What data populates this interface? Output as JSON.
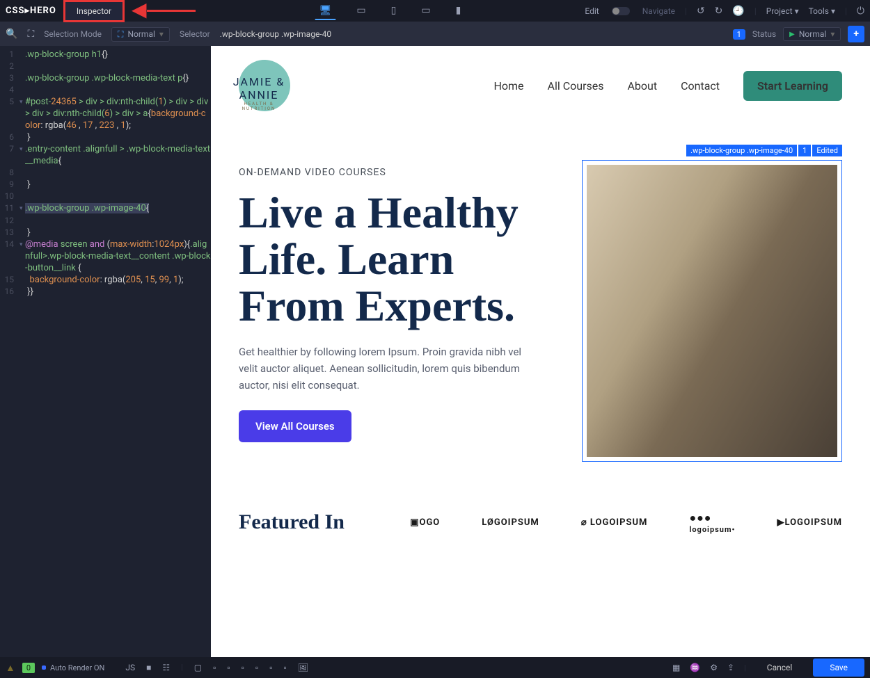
{
  "topbar": {
    "brand": "CSS▸HERO",
    "inspector_tab": "Inspector",
    "edit_label": "Edit",
    "navigate_label": "Navigate",
    "project_label": "Project",
    "tools_label": "Tools"
  },
  "subbar": {
    "selection_mode_label": "Selection Mode",
    "selection_mode_value": "Normal",
    "selector_label": "Selector",
    "selector_value": ".wp-block-group .wp-image-40",
    "count_badge": "1",
    "status_label": "Status",
    "status_value": "Normal"
  },
  "editor": {
    "lines": [
      {
        "n": "1",
        "c": ".wp-block-group h1{}"
      },
      {
        "n": "2",
        "c": ""
      },
      {
        "n": "3",
        "c": ".wp-block-group .wp-block-media-text p{}"
      },
      {
        "n": "4",
        "c": ""
      },
      {
        "n": "5",
        "c": "#post-24365 > div > div:nth-child(1) > div > div > div > div:nth-child(6) > div > a{background-color: rgba(46 , 17 , 223 , 1);"
      },
      {
        "n": "6",
        "c": " }"
      },
      {
        "n": "7",
        "c": ".entry-content .alignfull > .wp-block-media-text__media{"
      },
      {
        "n": "8",
        "c": ""
      },
      {
        "n": "9",
        "c": " }"
      },
      {
        "n": "10",
        "c": ""
      },
      {
        "n": "11",
        "c": ".wp-block-group .wp-image-40{",
        "hl": true
      },
      {
        "n": "12",
        "c": ""
      },
      {
        "n": "13",
        "c": " }"
      },
      {
        "n": "14",
        "c": "@media screen and (max-width:1024px){.alignfull>.wp-block-media-text__content .wp-block-button__link {"
      },
      {
        "n": "15",
        "c": "  background-color: rgba(205, 15, 99, 1);"
      },
      {
        "n": "16",
        "c": " }}"
      }
    ]
  },
  "preview": {
    "brand_main": "JAMIE & ANNIE",
    "brand_sub": "HEALTH & NUTRITION",
    "nav": {
      "home": "Home",
      "courses": "All Courses",
      "about": "About",
      "contact": "Contact",
      "cta": "Start Learning"
    },
    "hero": {
      "kicker": "ON-DEMAND VIDEO COURSES",
      "title": "Live a Healthy Life. Learn From Experts.",
      "lead": "Get healthier by following lorem Ipsum. Proin gravida nibh vel velit auctor aliquet. Aenean sollicitudin, lorem quis bibendum auctor, nisi elit consequat.",
      "button": "View All Courses"
    },
    "selection_tag": {
      "selector": ".wp-block-group .wp-image-40",
      "count": "1",
      "edited": "Edited"
    },
    "featured": {
      "title": "Featured In",
      "logos": [
        "▣OGO",
        "LØGOIPSUM",
        "⌀ LOGOIPSUM",
        "logoipsum•",
        "▶LOGOIPSUM"
      ]
    }
  },
  "bottombar": {
    "warning_count": "0",
    "auto_render": "Auto Render ON",
    "js_label": "JS",
    "cancel": "Cancel",
    "save": "Save"
  }
}
